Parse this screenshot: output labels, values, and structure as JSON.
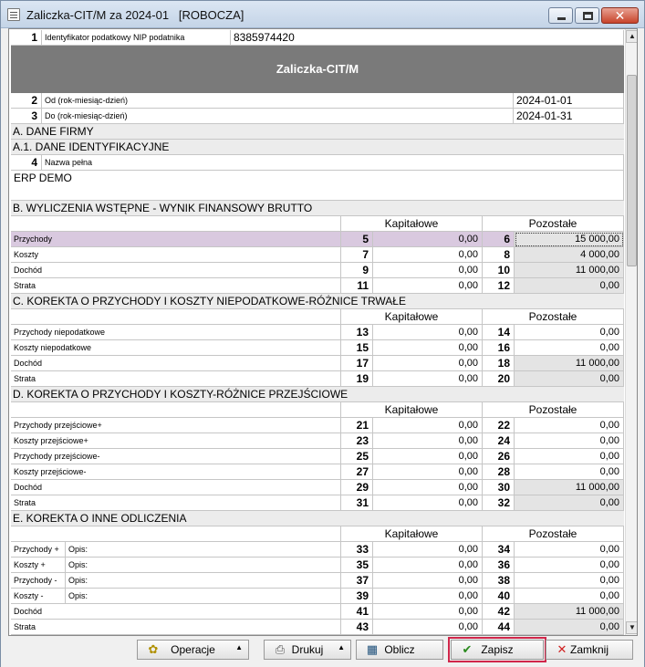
{
  "window": {
    "title": "Zaliczka-CIT/M za 2024-01   [ROBOCZA]"
  },
  "form": {
    "nip": {
      "num": "1",
      "label": "Identyfikator podatkowy NIP podatnika",
      "value": "8385974420"
    },
    "banner": "Zaliczka-CIT/M",
    "od": {
      "num": "2",
      "label": "Od (rok-miesiąc-dzień)",
      "value": "2024-01-01"
    },
    "do": {
      "num": "3",
      "label": "Do (rok-miesiąc-dzień)",
      "value": "2024-01-31"
    },
    "secA": "A. DANE FIRMY",
    "secA1": "A.1. DANE IDENTYFIKACYJNE",
    "nazwa": {
      "num": "4",
      "label": "Nazwa pełna",
      "value": "ERP DEMO"
    },
    "col_kap": "Kapitałowe",
    "col_poz": "Pozostałe",
    "secB": {
      "title": "B. WYLICZENIA WSTĘPNE - WYNIK FINANSOWY BRUTTO",
      "rows": [
        {
          "label": "Przychody",
          "n1": "5",
          "v1": "0,00",
          "n2": "6",
          "v2": "15 000,00"
        },
        {
          "label": "Koszty",
          "n1": "7",
          "v1": "0,00",
          "n2": "8",
          "v2": "4 000,00"
        },
        {
          "label": "Dochód",
          "n1": "9",
          "v1": "0,00",
          "n2": "10",
          "v2": "11 000,00"
        },
        {
          "label": "Strata",
          "n1": "11",
          "v1": "0,00",
          "n2": "12",
          "v2": "0,00"
        }
      ]
    },
    "secC": {
      "title": "C. KOREKTA O PRZYCHODY I KOSZTY NIEPODATKOWE-RÓŻNICE TRWAŁE",
      "rows": [
        {
          "label": "Przychody niepodatkowe",
          "n1": "13",
          "v1": "0,00",
          "n2": "14",
          "v2": "0,00"
        },
        {
          "label": "Koszty niepodatkowe",
          "n1": "15",
          "v1": "0,00",
          "n2": "16",
          "v2": "0,00"
        },
        {
          "label": "Dochód",
          "n1": "17",
          "v1": "0,00",
          "n2": "18",
          "v2": "11 000,00"
        },
        {
          "label": "Strata",
          "n1": "19",
          "v1": "0,00",
          "n2": "20",
          "v2": "0,00"
        }
      ]
    },
    "secD": {
      "title": "D. KOREKTA O PRZYCHODY I KOSZTY-RÓŻNICE PRZEJŚCIOWE",
      "rows": [
        {
          "label": "Przychody przejściowe+",
          "n1": "21",
          "v1": "0,00",
          "n2": "22",
          "v2": "0,00"
        },
        {
          "label": "Koszty przejściowe+",
          "n1": "23",
          "v1": "0,00",
          "n2": "24",
          "v2": "0,00"
        },
        {
          "label": "Przychody przejściowe-",
          "n1": "25",
          "v1": "0,00",
          "n2": "26",
          "v2": "0,00"
        },
        {
          "label": "Koszty przejściowe-",
          "n1": "27",
          "v1": "0,00",
          "n2": "28",
          "v2": "0,00"
        },
        {
          "label": "Dochód",
          "n1": "29",
          "v1": "0,00",
          "n2": "30",
          "v2": "11 000,00"
        },
        {
          "label": "Strata",
          "n1": "31",
          "v1": "0,00",
          "n2": "32",
          "v2": "0,00"
        }
      ]
    },
    "secE": {
      "title": "E. KOREKTA O INNE ODLICZENIA",
      "opis": "Opis:",
      "rows": [
        {
          "label": "Przychody +",
          "n1": "33",
          "v1": "0,00",
          "n2": "34",
          "v2": "0,00"
        },
        {
          "label": "Koszty +",
          "n1": "35",
          "v1": "0,00",
          "n2": "36",
          "v2": "0,00"
        },
        {
          "label": "Przychody -",
          "n1": "37",
          "v1": "0,00",
          "n2": "38",
          "v2": "0,00"
        },
        {
          "label": "Koszty -",
          "n1": "39",
          "v1": "0,00",
          "n2": "40",
          "v2": "0,00"
        },
        {
          "label": "Dochód",
          "n1": "41",
          "v1": "0,00",
          "n2": "42",
          "v2": "11 000,00"
        },
        {
          "label": "Strata",
          "n1": "43",
          "v1": "0,00",
          "n2": "44",
          "v2": "0,00"
        }
      ]
    }
  },
  "buttons": {
    "operacje": "Operacje",
    "drukuj": "Drukuj",
    "oblicz": "Oblicz",
    "zapisz": "Zapisz",
    "zamknij": "Zamknij"
  }
}
